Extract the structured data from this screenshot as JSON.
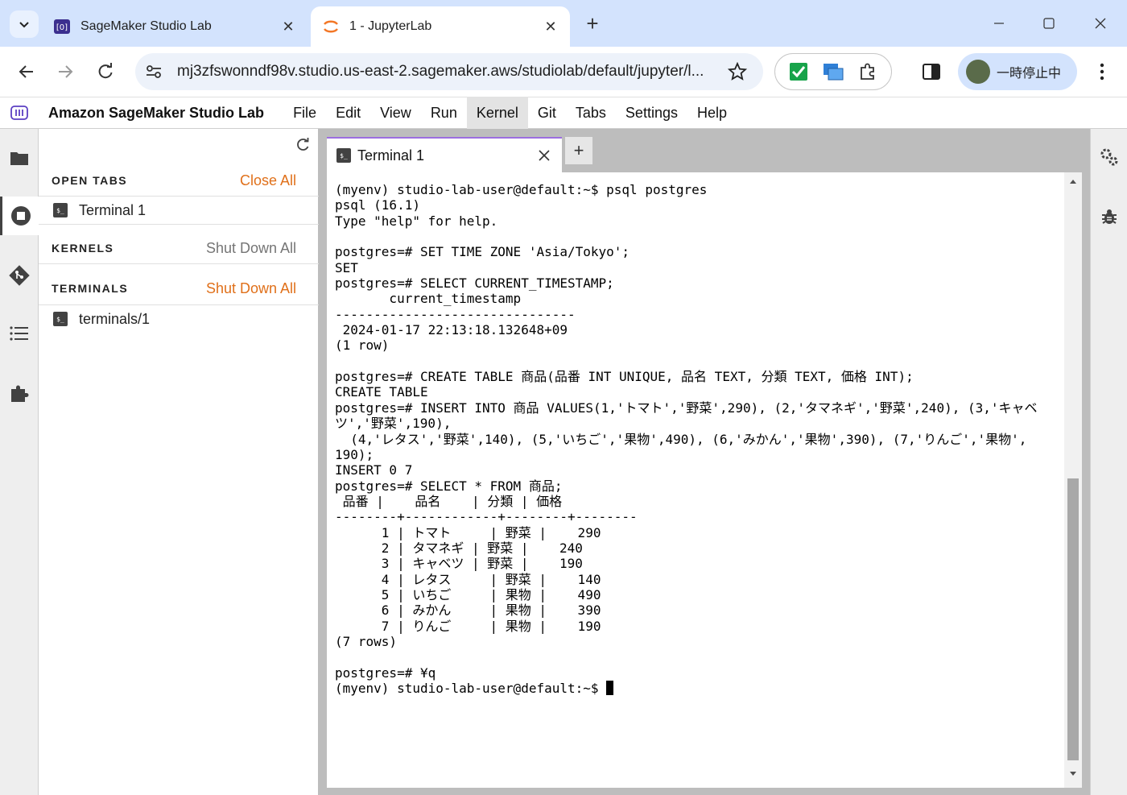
{
  "browser": {
    "tabs": [
      {
        "title": "SageMaker Studio Lab",
        "active": false
      },
      {
        "title": "1 - JupyterLab",
        "active": true
      }
    ],
    "url": "mj3zfswonndf98v.studio.us-east-2.sagemaker.aws/studiolab/default/jupyter/l...",
    "profile_label": "一時停止中"
  },
  "menubar": {
    "app_title": "Amazon SageMaker Studio Lab",
    "items": [
      "File",
      "Edit",
      "View",
      "Run",
      "Kernel",
      "Git",
      "Tabs",
      "Settings",
      "Help"
    ],
    "active_item": "Kernel"
  },
  "panel": {
    "open_tabs": {
      "title": "OPEN TABS",
      "action": "Close All",
      "items": [
        "Terminal 1"
      ]
    },
    "kernels": {
      "title": "KERNELS",
      "action": "Shut Down All"
    },
    "terminals": {
      "title": "TERMINALS",
      "action": "Shut Down All",
      "items": [
        "terminals/1"
      ]
    }
  },
  "main": {
    "tab_label": "Terminal 1",
    "terminal_lines": [
      "(myenv) studio-lab-user@default:~$ psql postgres",
      "psql (16.1)",
      "Type \"help\" for help.",
      "",
      "postgres=# SET TIME ZONE 'Asia/Tokyo';",
      "SET",
      "postgres=# SELECT CURRENT_TIMESTAMP;",
      "       current_timestamp",
      "-------------------------------",
      " 2024-01-17 22:13:18.132648+09",
      "(1 row)",
      "",
      "postgres=# CREATE TABLE 商品(品番 INT UNIQUE, 品名 TEXT, 分類 TEXT, 価格 INT);",
      "CREATE TABLE",
      "postgres=# INSERT INTO 商品 VALUES(1,'トマト','野菜',290), (2,'タマネギ','野菜',240), (3,'キャベ",
      "ツ','野菜',190),",
      "  (4,'レタス','野菜',140), (5,'いちご','果物',490), (6,'みかん','果物',390), (7,'りんご','果物',",
      "190);",
      "INSERT 0 7",
      "postgres=# SELECT * FROM 商品;",
      " 品番 |    品名    | 分類 | 価格",
      "--------+------------+--------+--------",
      "      1 | トマト     | 野菜 |    290",
      "      2 | タマネギ | 野菜 |    240",
      "      3 | キャベツ | 野菜 |    190",
      "      4 | レタス     | 野菜 |    140",
      "      5 | いちご     | 果物 |    490",
      "      6 | みかん     | 果物 |    390",
      "      7 | りんご     | 果物 |    190",
      "(7 rows)",
      "",
      "postgres=# ¥q",
      "(myenv) studio-lab-user@default:~$ "
    ]
  },
  "colors": {
    "accent_orange": "#e0701a",
    "tab_active_border": "#9c6ee0",
    "chrome_blue": "#d3e3fd"
  },
  "icons": {
    "left_bar": [
      "folder-icon",
      "running-icon",
      "git-icon",
      "toc-icon",
      "extension-icon"
    ],
    "right_bar": [
      "property-inspector-icon",
      "debugger-icon"
    ]
  }
}
